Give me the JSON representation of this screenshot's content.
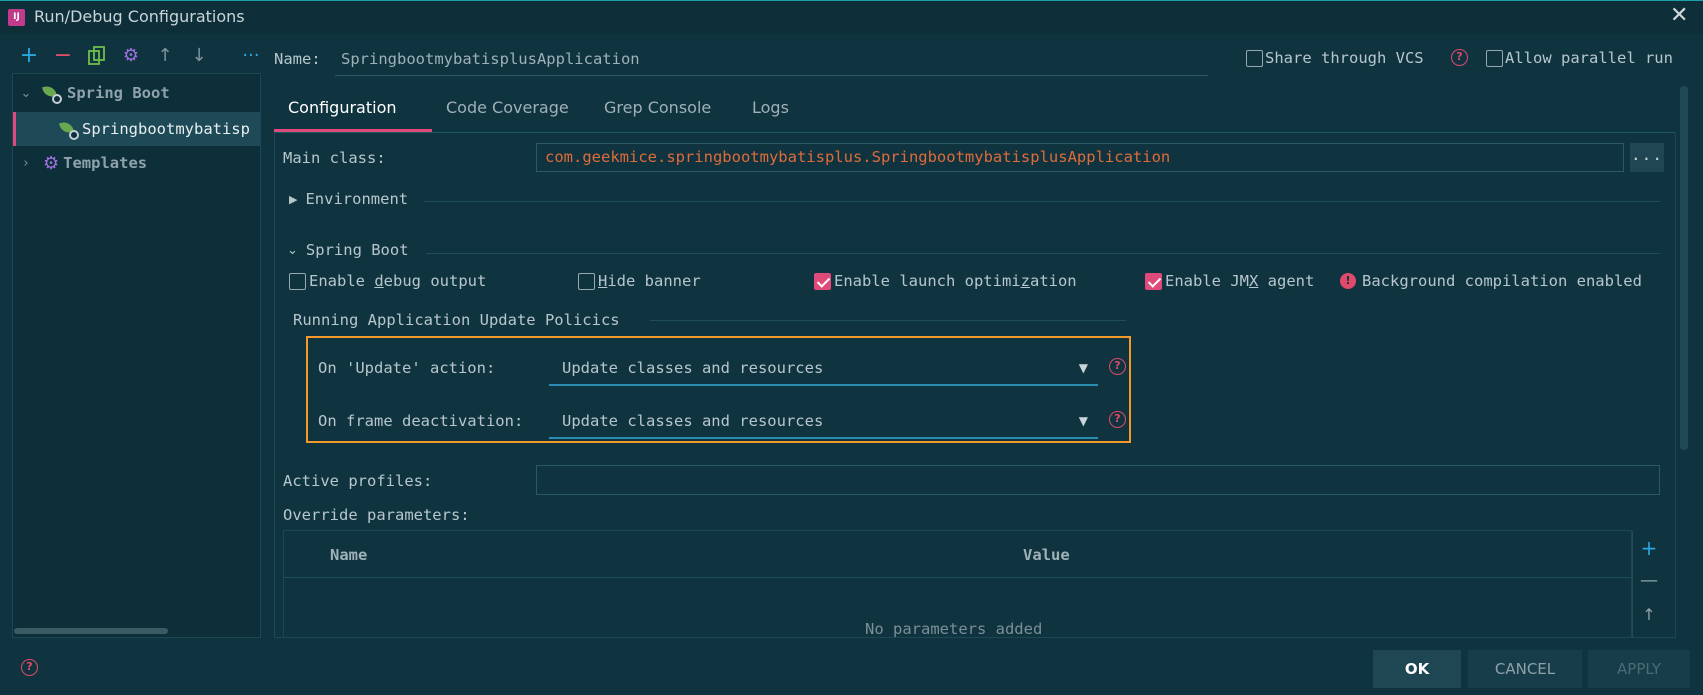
{
  "window": {
    "title": "Run/Debug Configurations",
    "app_icon_text": "IJ"
  },
  "toolbar": {
    "add_icon": "plus-icon",
    "remove_icon": "minus-icon",
    "copy_icon": "copy-icon",
    "settings_icon": "gear-icon",
    "up_icon": "arrow-up-icon",
    "down_icon": "arrow-down-icon",
    "more_icon": "more-icon"
  },
  "tree": {
    "items": [
      {
        "label": "Spring Boot",
        "icon": "spring-boot-icon"
      },
      {
        "label": "Springbootmybatisp",
        "icon": "spring-boot-icon"
      },
      {
        "label": "Templates",
        "icon": "gear-icon"
      }
    ]
  },
  "name": {
    "label": "Name:",
    "value": "SpringbootmybatisplusApplication"
  },
  "options_top": {
    "share_vcs": {
      "label": "Share through VCS",
      "checked": false
    },
    "allow_parallel": {
      "label": "Allow parallel run",
      "checked": false
    }
  },
  "tabs": [
    {
      "label": "Configuration",
      "active": true
    },
    {
      "label": "Code Coverage",
      "active": false
    },
    {
      "label": "Grep Console",
      "active": false
    },
    {
      "label": "Logs",
      "active": false
    }
  ],
  "config": {
    "main_class_label": "Main class:",
    "main_class_value": "com.geekmice.springbootmybatisplus.SpringbootmybatisplusApplication",
    "browse_label": "...",
    "environment_label": "Environment",
    "spring_boot_label": "Spring Boot",
    "debug_output": {
      "pre": "Enable ",
      "mn": "d",
      "post": "ebug output",
      "checked": false
    },
    "hide_banner": {
      "pre": "",
      "mn": "H",
      "post": "ide banner",
      "checked": false
    },
    "launch_opt": {
      "pre": "Enable launch optimi",
      "mn": "z",
      "post": "ation",
      "checked": true
    },
    "jmx_agent": {
      "pre": "Enable JM",
      "mn": "X",
      "post": " agent",
      "checked": true
    },
    "bg_compilation": "Background compilation enabled",
    "policies_title": "Running Application Update Policics",
    "update_action_label": "On 'Update' action:",
    "update_action_value": "Update classes and resources",
    "frame_deact_label": "On frame deactivation:",
    "frame_deact_value": "Update classes and resources",
    "active_profiles_label": "Active profiles:",
    "active_profiles_value": "",
    "override_label": "Override parameters:",
    "table": {
      "columns": [
        "Name",
        "Value"
      ],
      "empty_text": "No parameters added"
    }
  },
  "buttons": {
    "ok": "OK",
    "cancel": "CANCEL",
    "apply": "APPLY"
  },
  "colors": {
    "accent": "#e04a7a",
    "highlight_box": "#f39a2a",
    "main_class_text": "#e06a3a",
    "background": "#0f3440"
  }
}
